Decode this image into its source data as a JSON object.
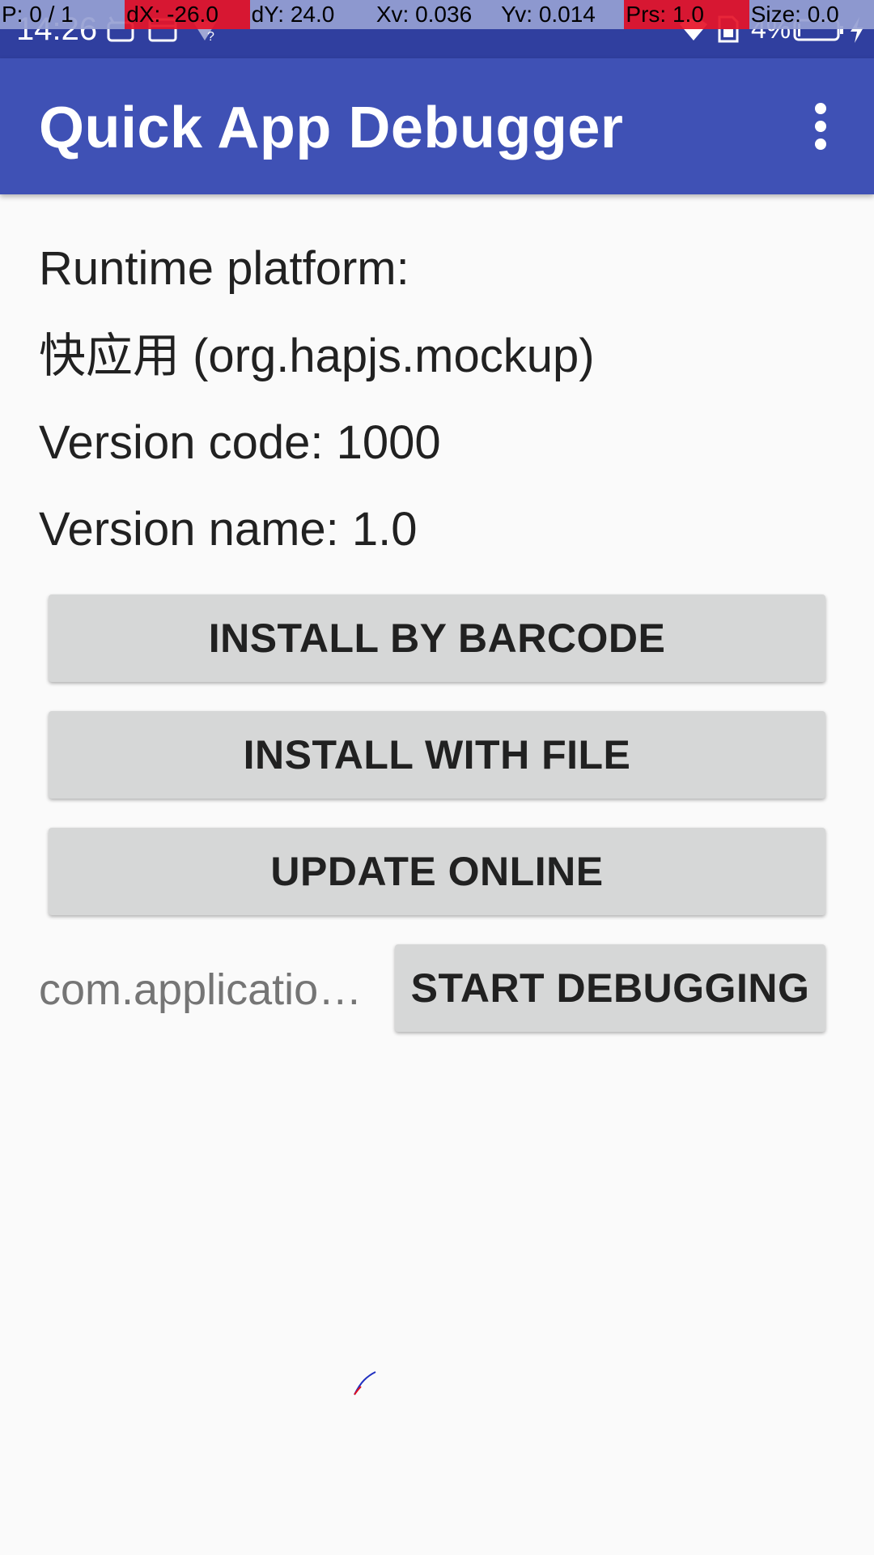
{
  "status_bar": {
    "time": "14:26",
    "battery_percent": "4%",
    "icons": [
      "android-icon",
      "calendar-icon",
      "signal-unknown-icon",
      "wifi-icon",
      "sim-card-icon",
      "battery-low-icon",
      "charging-bolt-icon"
    ]
  },
  "pointer_overlay": {
    "pointer": "P: 0 / 1",
    "dx": "dX: -26.0",
    "dy": "dY: 24.0",
    "xv": "Xv: 0.036",
    "yv": "Yv: 0.014",
    "prs": "Prs: 1.0",
    "size": "Size: 0.0"
  },
  "app_bar": {
    "title": "Quick App Debugger",
    "menu_icon": "overflow-menu-icon"
  },
  "info": {
    "platform_label": "Runtime platform:",
    "platform_value": "快应用 (org.hapjs.mockup)",
    "version_code": "Version code: 1000",
    "version_name": "Version name: 1.0"
  },
  "buttons": {
    "install_barcode": "INSTALL BY BARCODE",
    "install_file": "INSTALL WITH FILE",
    "update_online": "UPDATE ONLINE",
    "start_debugging": "START DEBUGGING"
  },
  "package_field": {
    "value": "com.application.demo"
  },
  "colors": {
    "status_bar": "#303f9f",
    "app_bar": "#3f51b5",
    "button": "#d6d7d7",
    "background": "#fafafa",
    "overlay_highlight": "#e61428",
    "overlay_normal": "#96a0d2"
  }
}
